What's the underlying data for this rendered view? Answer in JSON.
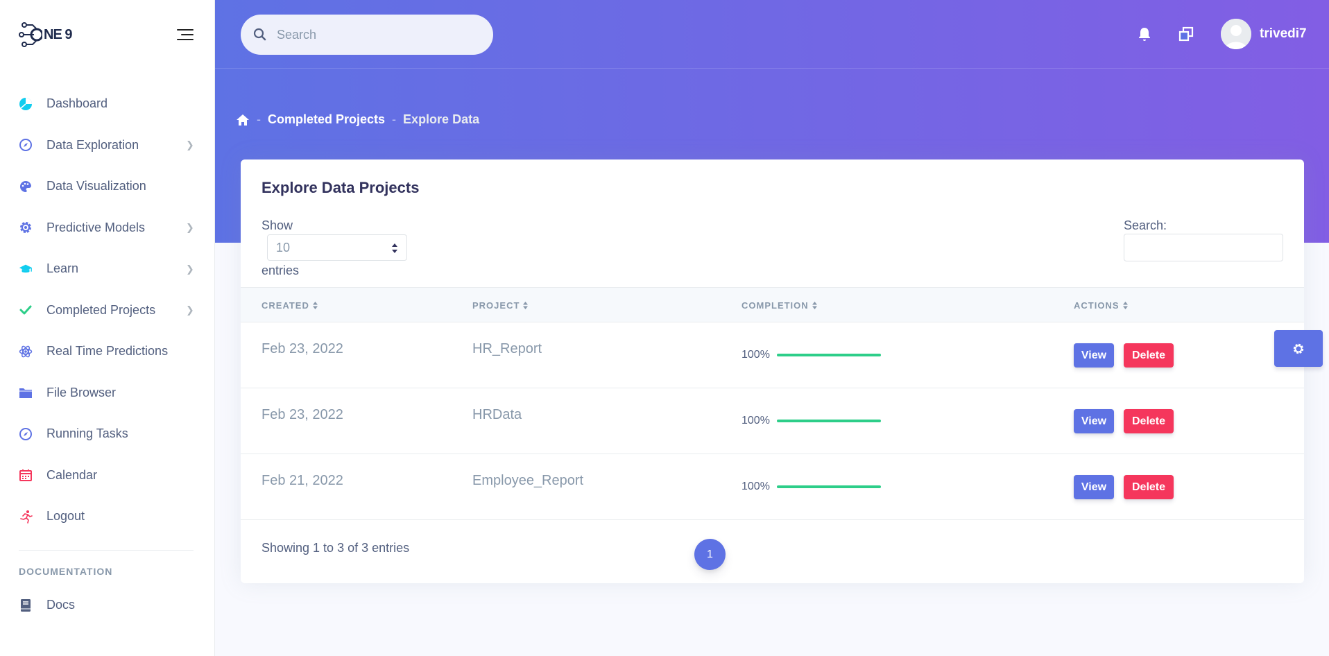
{
  "brand": {
    "name": "NE 9",
    "icon": "circuit-logo"
  },
  "colors": {
    "primary": "#5e72e4",
    "gradient_end": "#825ee4",
    "success": "#2dce89",
    "danger": "#f5365c"
  },
  "sidebar": {
    "items": [
      {
        "label": "Dashboard",
        "icon": "pie-chart-icon",
        "color": "#11cdef",
        "chevron": false
      },
      {
        "label": "Data Exploration",
        "icon": "compass-icon",
        "color": "#5e72e4",
        "chevron": true
      },
      {
        "label": "Data Visualization",
        "icon": "palette-icon",
        "color": "#5e72e4",
        "chevron": false
      },
      {
        "label": "Predictive Models",
        "icon": "gear-icon",
        "color": "#5e72e4",
        "chevron": true
      },
      {
        "label": "Learn",
        "icon": "graduation-cap-icon",
        "color": "#11cdef",
        "chevron": true
      },
      {
        "label": "Completed Projects",
        "icon": "check-icon",
        "color": "#2dce89",
        "chevron": true
      },
      {
        "label": "Real Time Predictions",
        "icon": "atom-icon",
        "color": "#5e72e4",
        "chevron": false
      },
      {
        "label": "File Browser",
        "icon": "folder-icon",
        "color": "#5e72e4",
        "chevron": false
      },
      {
        "label": "Running Tasks",
        "icon": "compass-icon",
        "color": "#5e72e4",
        "chevron": false
      },
      {
        "label": "Calendar",
        "icon": "calendar-icon",
        "color": "#f5365c",
        "chevron": false
      },
      {
        "label": "Logout",
        "icon": "running-icon",
        "color": "#f5365c",
        "chevron": false
      }
    ],
    "doc_heading": "DOCUMENTATION",
    "docs_label": "Docs"
  },
  "topbar": {
    "search_placeholder": "Search",
    "username": "trivedi7"
  },
  "breadcrumb": {
    "items": [
      "Completed Projects",
      "Explore Data"
    ]
  },
  "card": {
    "title": "Explore Data Projects",
    "show_label": "Show",
    "page_length": "10",
    "entries_label": "entries",
    "search_label": "Search:",
    "columns": [
      "CREATED",
      "PROJECT",
      "COMPLETION",
      "ACTIONS"
    ],
    "rows": [
      {
        "created": "Feb 23, 2022",
        "project": "HR_Report",
        "completion": "100%",
        "completion_value": 1.0
      },
      {
        "created": "Feb 23, 2022",
        "project": "HRData",
        "completion": "100%",
        "completion_value": 1.0
      },
      {
        "created": "Feb 21, 2022",
        "project": "Employee_Report",
        "completion": "100%",
        "completion_value": 1.0
      }
    ],
    "view_label": "View",
    "delete_label": "Delete",
    "info": "Showing 1 to 3 of 3 entries",
    "current_page": "1"
  }
}
